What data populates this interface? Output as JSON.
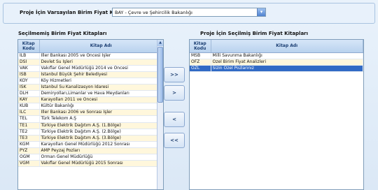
{
  "header": {
    "label": "Proje İçin Varsayılan Birim Fiyat Kitabı",
    "selected_value": "BAY - Çevre ve Şehircilik Bakanlığı"
  },
  "left_panel": {
    "title": "Seçilmemiş Birim Fiyat Kitapları",
    "col_code": "Kitap Kodu",
    "col_name": "Kitap Adı",
    "rows": [
      {
        "code": "İLB",
        "name": "İller Bankası 2005 ve Öncesi İşler"
      },
      {
        "code": "DSİ",
        "name": "Devlet Su İşleri"
      },
      {
        "code": "VAK",
        "name": "Vakıflar Genel Müdürlüğü 2014 ve Öncesi"
      },
      {
        "code": "İSB",
        "name": "İstanbul Büyük Şehir Belediyesi"
      },
      {
        "code": "KÖY",
        "name": "Köy Hizmetleri"
      },
      {
        "code": "İSK",
        "name": "İstanbul Su Kanalizasyon İdaresi"
      },
      {
        "code": "DLH",
        "name": "Demiryolları,Limanlar ve Hava Meydanları"
      },
      {
        "code": "KAY",
        "name": "Karayolları 2011 ve Öncesi"
      },
      {
        "code": "KUB",
        "name": "Kültür Bakanlığı"
      },
      {
        "code": "İLC",
        "name": "İller Bankası 2006 ve Sonrası İşler"
      },
      {
        "code": "TEL",
        "name": "Türk Telekom A.Ş"
      },
      {
        "code": "TE1",
        "name": "Türkiye Elektrik Dağıtım A.Ş. (1.Bölge)"
      },
      {
        "code": "TE2",
        "name": "Türkiye Elektrik Dağıtım A.Ş. (2.Bölge)"
      },
      {
        "code": "TE3",
        "name": "Türkiye Elektrik Dağıtım A.Ş. (3.Bölge)"
      },
      {
        "code": "KGM",
        "name": "Karayolları Genel Müdürlüğü 2012 Sonrası"
      },
      {
        "code": "PYZ",
        "name": "AMP Peyzaj Pozları"
      },
      {
        "code": "OGM",
        "name": "Orman Genel Müdürlüğü"
      },
      {
        "code": "VGM",
        "name": "Vakıflar Genel Müdürlüğü 2015 Sonrası"
      }
    ]
  },
  "right_panel": {
    "title": "Proje İçin Seçilmiş Birim Fiyat Kitapları",
    "col_code": "Kitap Kodu",
    "col_name": "Kitap Adı",
    "rows": [
      {
        "code": "MSB",
        "name": "Milli Savunma Bakanlığı"
      },
      {
        "code": "ÖFZ",
        "name": "Özel Birim Fiyat Analizleri"
      },
      {
        "code": "ÖZL",
        "name": "Sizin Özel Pozlarınız"
      }
    ]
  },
  "buttons": {
    "move_all_right": ">>",
    "move_right": ">",
    "move_left": "<",
    "move_all_left": "<<"
  },
  "icons": {
    "combo_dropdown": "chevron-down-icon",
    "scroll_up": "scroll-up-arrow-icon"
  },
  "colors": {
    "selection": "#316ac5",
    "alt_row": "#fff7dc",
    "header_text": "#1c3f73"
  }
}
